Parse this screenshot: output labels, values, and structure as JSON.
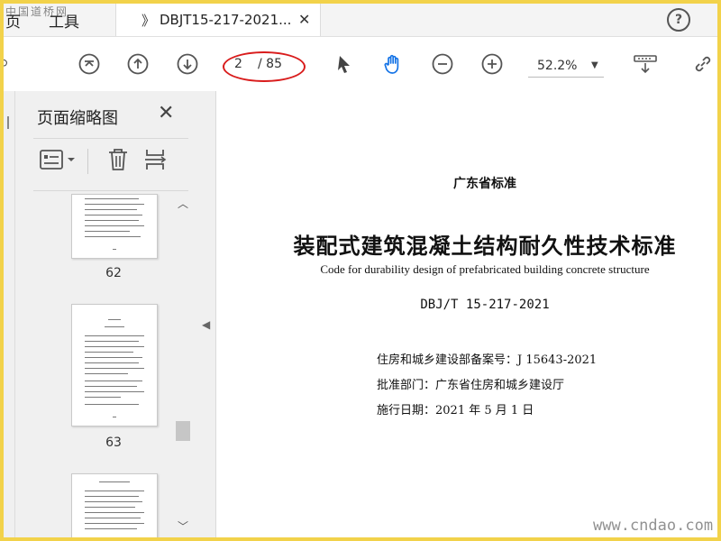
{
  "tabs": {
    "home_label": "页",
    "tools_label": "工具",
    "doc_tab_label": "DBJT15-217-2021...",
    "close_symbol": "✕",
    "help_symbol": "?"
  },
  "watermarks": {
    "top": "中国道桥网",
    "bottom": "www.cndao.com"
  },
  "toolbar": {
    "current_page": "2",
    "total_pages": "/ 85",
    "zoom": "52.2%",
    "icons": [
      "first-page-icon",
      "previous-page-icon",
      "next-page-icon",
      "select-arrow-icon",
      "hand-tool-icon",
      "zoom-out-icon",
      "zoom-in-icon",
      "scroll-mode-icon",
      "link-icon"
    ],
    "annotation_color": "#d91c1c"
  },
  "thumbnail_panel": {
    "title": "页面缩略图",
    "close_symbol": "✕",
    "thumbnails": [
      {
        "page_label": "62"
      },
      {
        "page_label": "63"
      }
    ]
  },
  "document": {
    "standard_type": "广东省标准",
    "title_cn": "装配式建筑混凝土结构耐久性技术标准",
    "title_en": "Code for durability design of prefabricated building concrete structure",
    "code": "DBJ/T 15-217-2021",
    "record_no": "住房和城乡建设部备案号：J 15643-2021",
    "approver": "批准部门：广东省住房和城乡建设厅",
    "effective_date": "施行日期：2021 年 5 月 1 日"
  },
  "colors": {
    "frame_border": "#f2d24a",
    "accent_blue": "#1473e6",
    "panel_bg": "#f0f0f0"
  }
}
